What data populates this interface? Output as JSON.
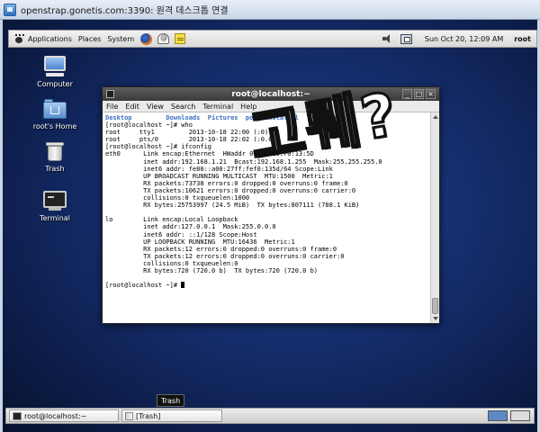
{
  "rdp": {
    "title": "openstrap.gonetis.com:3390: 원격 데스크톱 연결"
  },
  "top_panel": {
    "applications": "Applications",
    "places": "Places",
    "system": "System",
    "clock": "Sun Oct 20, 12:09 AM",
    "user": "root"
  },
  "desktop_icons": [
    {
      "label": "Computer"
    },
    {
      "label": "root's Home"
    },
    {
      "label": "Trash"
    },
    {
      "label": "Terminal"
    }
  ],
  "terminal": {
    "title": "root@localhost:~",
    "menu": [
      "File",
      "Edit",
      "View",
      "Search",
      "Terminal",
      "Help"
    ],
    "lines": [
      "Desktop         Downloads  Pictures  post-install.l  Templates",
      "[root@localhost ~]# who",
      "root     tty1         2013-10-18 22:00 (:0)",
      "root     pts/0        2013-10-18 22:02 (:0.0)",
      "[root@localhost ~]# ifconfig",
      "eth0      Link encap:Ethernet  HWaddr 00:0C:29:F0:13:5D",
      "          inet addr:192.168.1.21  Bcast:192.168.1.255  Mask:255.255.255.0",
      "          inet6 addr: fe80::a00:27ff:fef0:135d/64 Scope:Link",
      "          UP BROADCAST RUNNING MULTICAST  MTU:1500  Metric:1",
      "          RX packets:73738 errors:0 dropped:0 overruns:0 frame:0",
      "          TX packets:10621 errors:0 dropped:0 overruns:0 carrier:0",
      "          collisions:0 txqueuelen:1000",
      "          RX bytes:25753997 (24.5 MiB)  TX bytes:807111 (788.1 KiB)",
      "",
      "lo        Link encap:Local Loopback",
      "          inet addr:127.0.0.1  Mask:255.0.0.0",
      "          inet6 addr: ::1/128 Scope:Host",
      "          UP LOOPBACK RUNNING  MTU:16436  Metric:1",
      "          RX packets:12 errors:0 dropped:0 overruns:0 frame:0",
      "          TX packets:12 errors:0 dropped:0 overruns:0 carrier:0",
      "          collisions:0 txqueuelen:0",
      "          RX bytes:720 (720.0 b)  TX bytes:720 (720.0 b)",
      "",
      "[root@localhost ~]# "
    ]
  },
  "overlay": {
    "text": "고뤠?"
  },
  "tooltip": {
    "text": "Trash"
  },
  "bottom_panel": {
    "tasks": [
      {
        "label": "root@localhost:~"
      },
      {
        "label": "[Trash]"
      }
    ]
  }
}
